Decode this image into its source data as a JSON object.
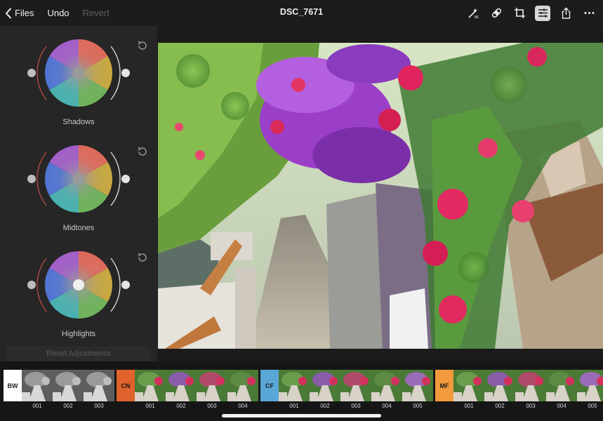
{
  "topbar": {
    "back_label": "Files",
    "undo_label": "Undo",
    "revert_label": "Revert",
    "title": "DSC_7671",
    "tools": [
      {
        "name": "ml-auto-icon"
      },
      {
        "name": "healing-bandage-icon"
      },
      {
        "name": "crop-icon"
      },
      {
        "name": "adjust-sliders-icon",
        "active": true
      },
      {
        "name": "share-icon"
      },
      {
        "name": "more-icon"
      }
    ]
  },
  "panel": {
    "wheels": [
      {
        "label": "Shadows"
      },
      {
        "label": "Midtones"
      },
      {
        "label": "Highlights"
      }
    ],
    "reset_label": "Reset Adjustments"
  },
  "filmstrip": {
    "groups": [
      {
        "code": "BW",
        "color": "#ffffff",
        "text_color": "#222222",
        "thumbs": [
          "001",
          "002",
          "003"
        ]
      },
      {
        "code": "CN",
        "color": "#e0622c",
        "text_color": "#1a1a1a",
        "thumbs": [
          "001",
          "002",
          "003",
          "004"
        ]
      },
      {
        "code": "CF",
        "color": "#5aa6d6",
        "text_color": "#1a1a1a",
        "thumbs": [
          "001",
          "002",
          "003",
          "004",
          "005"
        ]
      },
      {
        "code": "MF",
        "color": "#f29a3c",
        "text_color": "#1a1a1a",
        "thumbs": [
          "001",
          "002",
          "003",
          "004",
          "005"
        ]
      }
    ]
  },
  "colors": {
    "accent_active": "#d8d8d8",
    "panel_bg": "#262626"
  }
}
